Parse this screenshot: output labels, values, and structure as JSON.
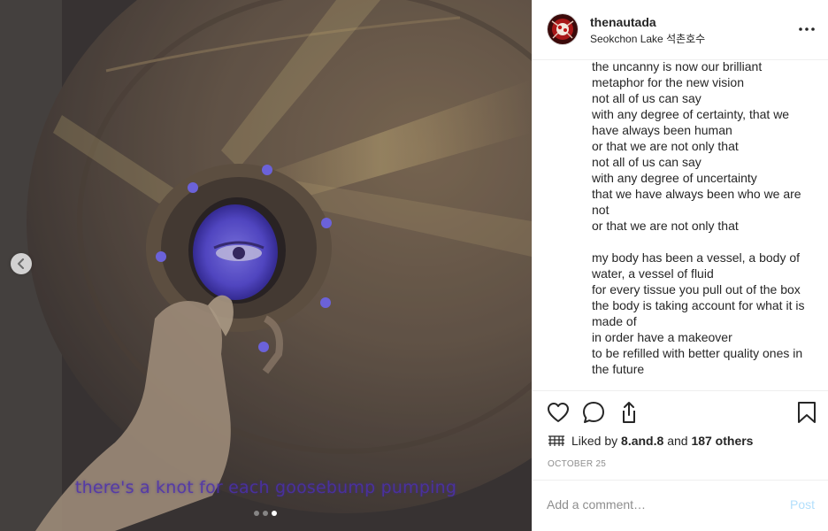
{
  "post": {
    "media": {
      "overlay_caption": "there's a knot for each goosebump pumping",
      "carousel_count": 3,
      "carousel_active": 3
    },
    "header": {
      "username": "thenautada",
      "location": "Seokchon Lake 석촌호수",
      "more_icon": "ellipsis-icon"
    },
    "caption_lines": [
      "the uncanny is now our brilliant",
      "metaphor for the new vision",
      "not all of us can say",
      "with any degree of certainty, that we",
      "have always been human",
      "or that we are not only that",
      "not all of us can say",
      "with any degree of uncertainty",
      "that we have always been who we are",
      "not",
      "or that we are not only that",
      "",
      "my body has been a vessel, a body of",
      "water, a vessel of fluid",
      "for every tissue you pull out of the box",
      "the body is taking account for what it is",
      "made of",
      "in order have a makeover",
      "to be refilled with better quality ones in",
      "the future"
    ],
    "likes": {
      "prefix": "Liked by",
      "user": "8.and.8",
      "middle": "and",
      "others": "187 others"
    },
    "date": "OCTOBER 25",
    "comment": {
      "placeholder": "Add a comment…",
      "value": "",
      "post_label": "Post"
    },
    "icons": [
      "heart-icon",
      "comment-icon",
      "share-icon",
      "bookmark-icon",
      "chevron-left-icon"
    ],
    "colors": {
      "post_disabled": "#b2dffc",
      "muted": "#8e8e8e",
      "text": "#262626",
      "overlay_text": "#4b2fb0"
    }
  }
}
